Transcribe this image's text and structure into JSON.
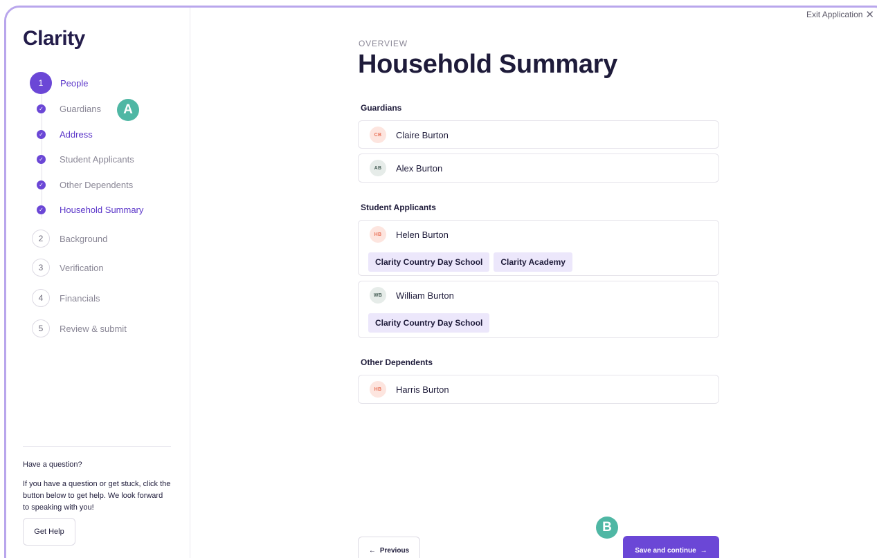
{
  "app": {
    "logo": "Clarity",
    "exit_label": "Exit Application"
  },
  "sidebar": {
    "steps": [
      {
        "num": "1",
        "label": "People"
      },
      {
        "num": "2",
        "label": "Background"
      },
      {
        "num": "3",
        "label": "Verification"
      },
      {
        "num": "4",
        "label": "Financials"
      },
      {
        "num": "5",
        "label": "Review & submit"
      }
    ],
    "substeps": [
      {
        "label": "Guardians"
      },
      {
        "label": "Address"
      },
      {
        "label": "Student Applicants"
      },
      {
        "label": "Other Dependents"
      },
      {
        "label": "Household Summary"
      }
    ],
    "help": {
      "title": "Have a question?",
      "text": "If you have a question or get stuck, click the button below to get help. We look forward to speaking with you!",
      "button": "Get Help"
    }
  },
  "markers": {
    "a": "A",
    "b": "B"
  },
  "main": {
    "eyebrow": "OVERVIEW",
    "title": "Household Summary",
    "sections": {
      "guardians": {
        "heading": "Guardians",
        "people": [
          {
            "initials": "CB",
            "name": "Claire Burton"
          },
          {
            "initials": "AB",
            "name": "Alex Burton"
          }
        ]
      },
      "students": {
        "heading": "Student Applicants",
        "people": [
          {
            "initials": "HB",
            "name": "Helen Burton",
            "schools": [
              "Clarity Country Day School",
              "Clarity Academy"
            ]
          },
          {
            "initials": "WB",
            "name": "William Burton",
            "schools": [
              "Clarity Country Day School"
            ]
          }
        ]
      },
      "dependents": {
        "heading": "Other Dependents",
        "people": [
          {
            "initials": "HB",
            "name": "Harris Burton"
          }
        ]
      }
    },
    "previous_label": "Previous",
    "save_label": "Save and continue"
  },
  "icons": {
    "check": "check-icon",
    "close": "close-icon",
    "arrow_left": "arrow-left-icon",
    "arrow_right": "arrow-right-icon"
  },
  "colors": {
    "accent": "#6b47d6",
    "marker": "#4fb7a4",
    "tag_bg": "#ece7fb"
  }
}
